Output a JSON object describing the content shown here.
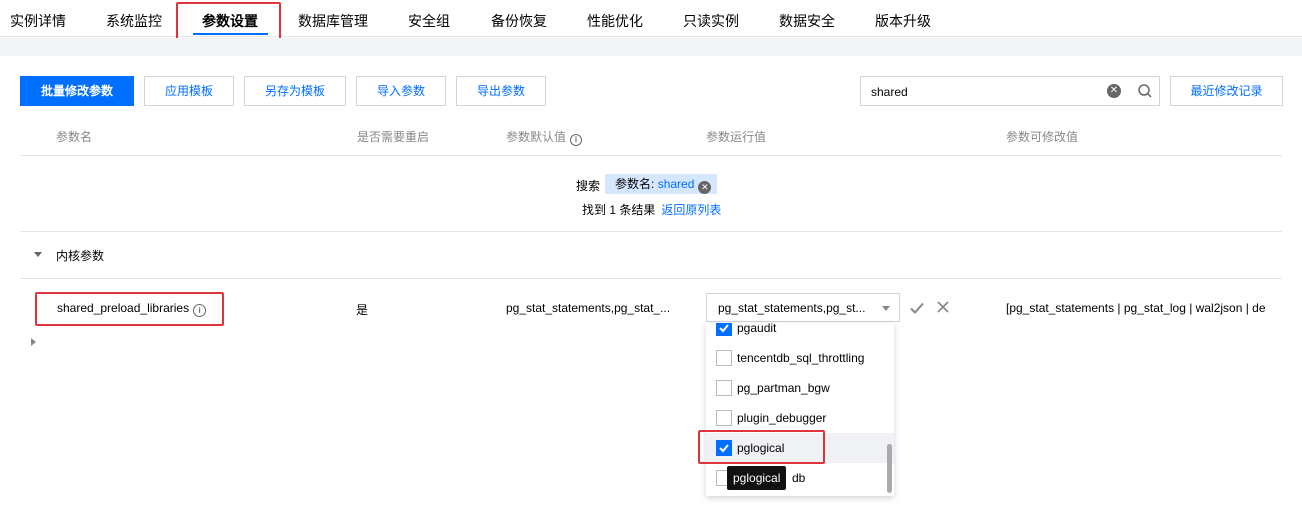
{
  "tabs": [
    {
      "label": "实例详情"
    },
    {
      "label": "系统监控"
    },
    {
      "label": "参数设置"
    },
    {
      "label": "数据库管理"
    },
    {
      "label": "安全组"
    },
    {
      "label": "备份恢复"
    },
    {
      "label": "性能优化"
    },
    {
      "label": "只读实例"
    },
    {
      "label": "数据安全"
    },
    {
      "label": "版本升级"
    }
  ],
  "toolbar": {
    "batch_modify": "批量修改参数",
    "apply_template": "应用模板",
    "save_as_template": "另存为模板",
    "import_params": "导入参数",
    "export_params": "导出参数",
    "recent_changes": "最近修改记录"
  },
  "search": {
    "value": "shared",
    "label": "搜索",
    "tag_key": "参数名:",
    "tag_value": "shared",
    "found": "找到 1 条结果",
    "back": "返回原列表"
  },
  "table": {
    "headers": {
      "name": "参数名",
      "restart": "是否需要重启",
      "default": "参数默认值",
      "running": "参数运行值",
      "allowed": "参数可修改值"
    },
    "group": "内核参数",
    "row": {
      "name": "shared_preload_libraries",
      "restart": "是",
      "default": "pg_stat_statements,pg_stat_...",
      "running": "pg_stat_statements,pg_st...",
      "allowed": "[pg_stat_statements | pg_stat_log | wal2json | de"
    }
  },
  "dropdown": {
    "options": [
      {
        "label": "pgaudit",
        "checked": true
      },
      {
        "label": "tencentdb_sql_throttling",
        "checked": false
      },
      {
        "label": "pg_partman_bgw",
        "checked": false
      },
      {
        "label": "plugin_debugger",
        "checked": false
      },
      {
        "label": "pglogical",
        "checked": true
      },
      {
        "label": "db",
        "checked": false
      }
    ],
    "tooltip": "pglogical"
  },
  "colors": {
    "accent": "#006eff",
    "highlight": "#e0343c"
  }
}
